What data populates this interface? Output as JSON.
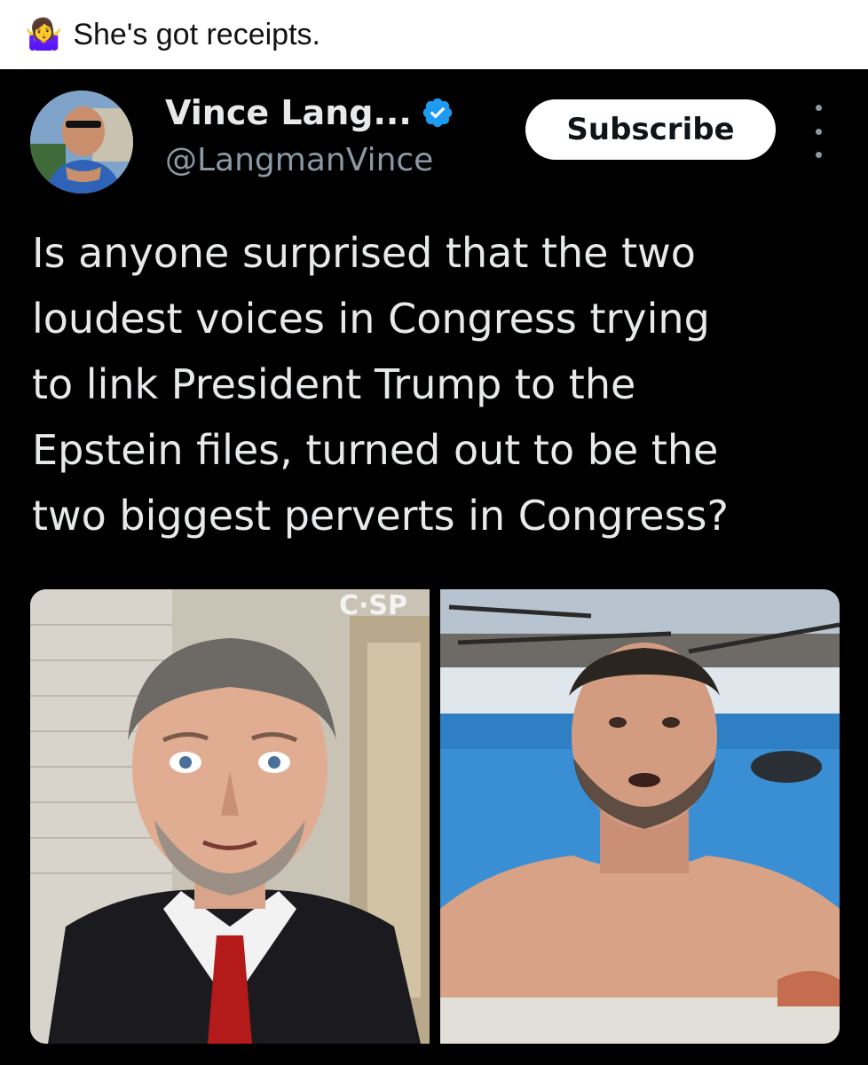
{
  "caption": {
    "emoji": "🤷‍♀️",
    "text": "She's got receipts."
  },
  "post": {
    "author": {
      "display_name": "Vince Lang...",
      "handle": "@LangmanVince",
      "verified": true
    },
    "subscribe_label": "Subscribe",
    "text_lines": [
      "Is anyone surprised that the two",
      "loudest voices in Congress trying",
      "to link President Trump to the",
      "Epstein files, turned out to be the",
      "two biggest perverts in Congress?"
    ],
    "media": {
      "left_photo_overlay_text": "C·SP"
    }
  },
  "colors": {
    "background": "#000000",
    "text_primary": "#e7e9ea",
    "text_secondary": "#8b98a5",
    "verified_blue": "#1d9bf0"
  }
}
